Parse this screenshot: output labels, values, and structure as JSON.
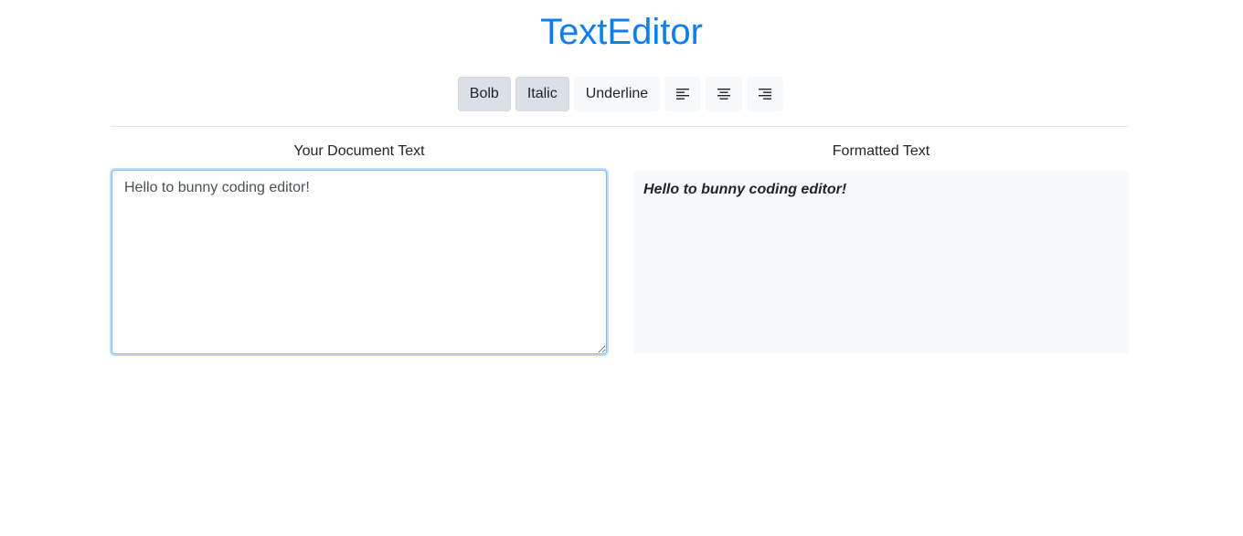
{
  "app": {
    "title": "TextEditor",
    "accent_color": "#0d7ef0"
  },
  "toolbar": {
    "bold_label": "Bolb",
    "italic_label": "Italic",
    "underline_label": "Underline",
    "bold_active": true,
    "italic_active": true,
    "underline_active": false,
    "align_left_icon": "align-left-icon",
    "align_center_icon": "align-center-icon",
    "align_right_icon": "align-right-icon"
  },
  "editor": {
    "input_label": "Your Document Text",
    "input_value": "Hello to bunny coding editor!",
    "output_label": "Formatted Text",
    "output_text": "Hello to bunny coding editor!",
    "alignment": "left"
  }
}
